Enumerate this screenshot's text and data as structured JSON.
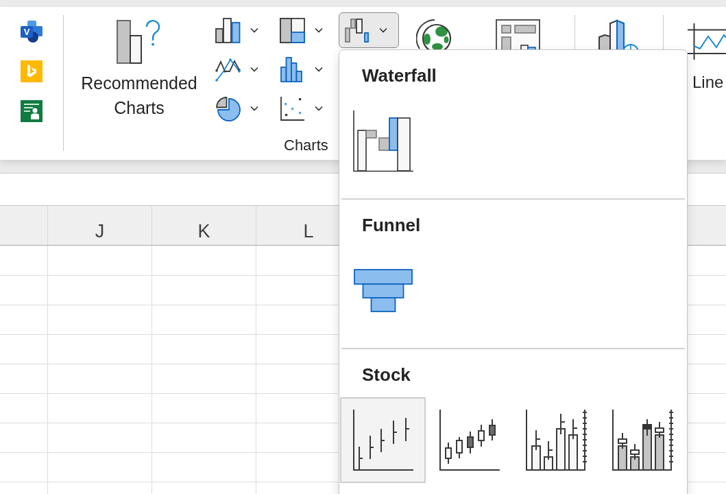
{
  "ribbon": {
    "add_ins": [
      {
        "kind": "diagram",
        "letter": "V"
      },
      {
        "kind": "web"
      },
      {
        "kind": "people"
      }
    ],
    "recommended_charts": {
      "label": "Recommended Charts"
    },
    "chart_type_buttons": [
      {
        "kind": "column",
        "selected": false
      },
      {
        "kind": "line",
        "selected": false
      },
      {
        "kind": "pie",
        "selected": false
      },
      {
        "kind": "hierarchy",
        "selected": false
      },
      {
        "kind": "statistic",
        "selected": false
      },
      {
        "kind": "scatter",
        "selected": false
      },
      {
        "kind": "waterfall",
        "selected": true
      }
    ],
    "charts_group_label": "Charts",
    "sparkline_line": {
      "label": "Line"
    }
  },
  "chart_menu": {
    "sections": [
      {
        "title": "Waterfall",
        "items": [
          {
            "kind": "waterfall",
            "selected": false
          }
        ]
      },
      {
        "title": "Funnel",
        "items": [
          {
            "kind": "funnel",
            "selected": false
          }
        ]
      },
      {
        "title": "Stock",
        "items": [
          {
            "kind": "high-low-close",
            "selected": true
          },
          {
            "kind": "open-high-low-close",
            "selected": false
          },
          {
            "kind": "volume-high-low-close",
            "selected": false
          },
          {
            "kind": "volume-open-high-low-close",
            "selected": false
          }
        ]
      }
    ]
  },
  "sheet": {
    "column_headers": [
      "J",
      "K",
      "L"
    ]
  }
}
